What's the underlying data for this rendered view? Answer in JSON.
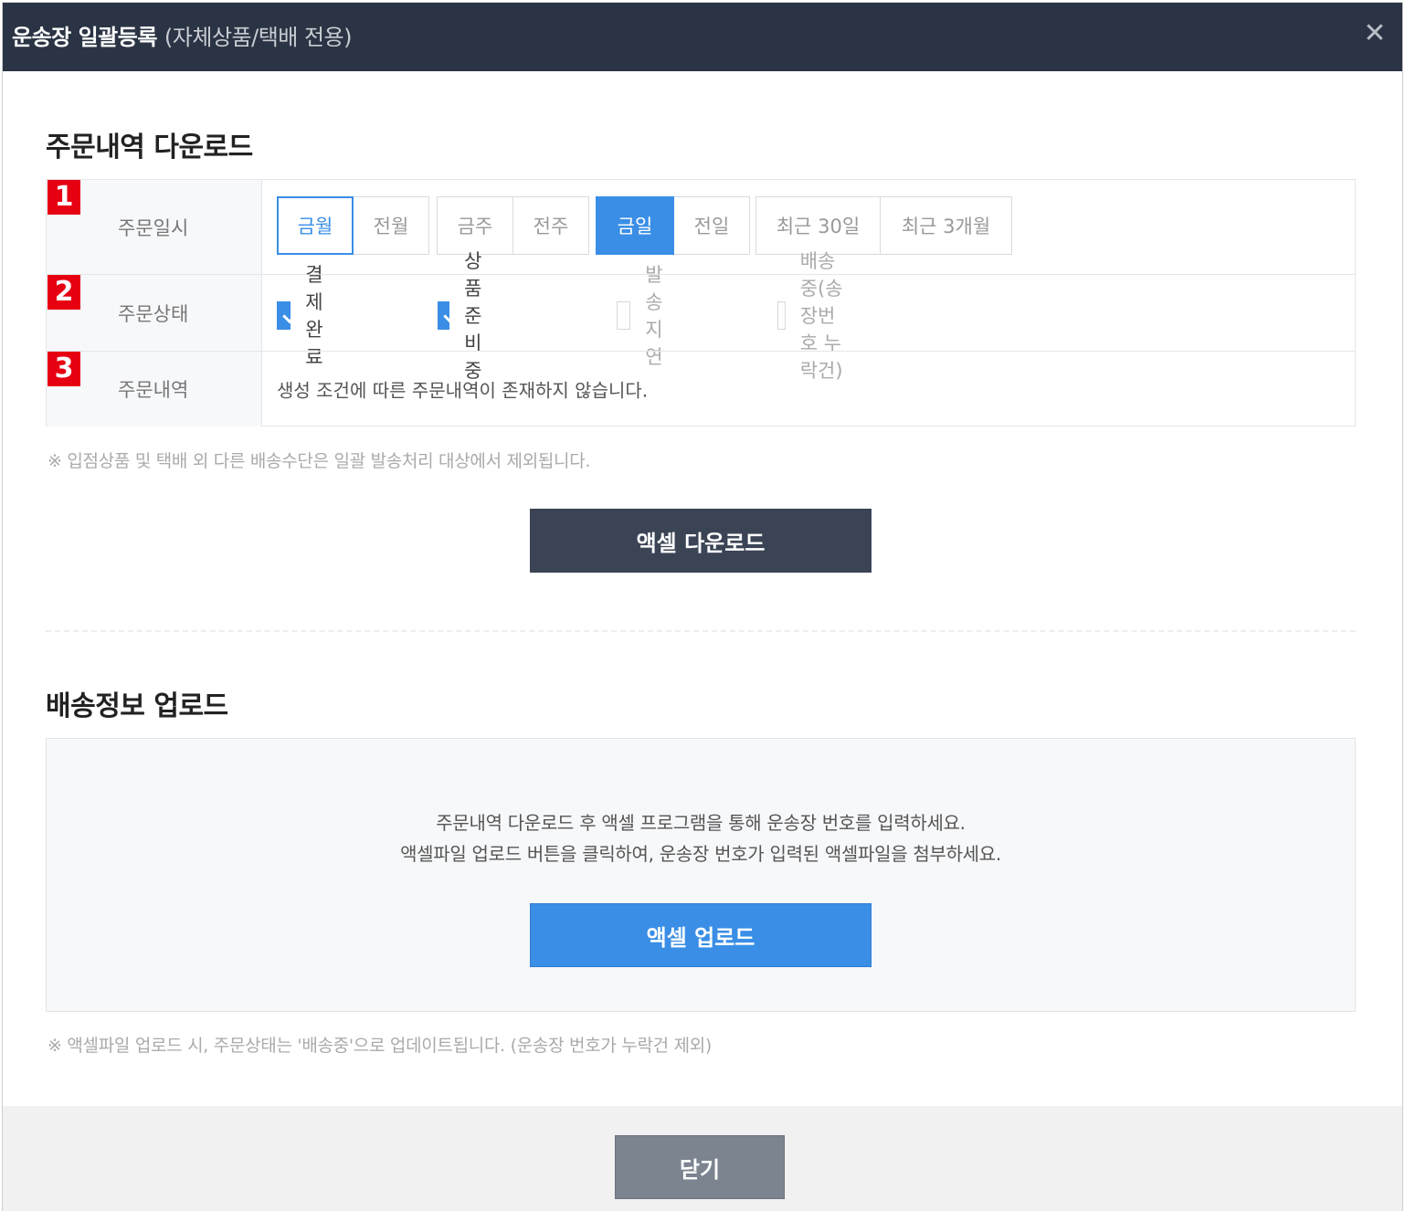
{
  "titlebar": {
    "title": "운송장 일괄등록",
    "subtitle": "(자체상품/택배 전용)",
    "close_icon": "close-icon"
  },
  "download_section": {
    "title": "주문내역 다운로드",
    "rows": [
      {
        "badge": "1",
        "label": "주문일시"
      },
      {
        "badge": "2",
        "label": "주문상태"
      },
      {
        "badge": "3",
        "label": "주문내역"
      }
    ],
    "date_groups": [
      [
        {
          "label": "금월",
          "state": "outline-active"
        },
        {
          "label": "전월",
          "state": "normal"
        }
      ],
      [
        {
          "label": "금주",
          "state": "normal"
        },
        {
          "label": "전주",
          "state": "normal"
        }
      ],
      [
        {
          "label": "금일",
          "state": "fill-active"
        },
        {
          "label": "전일",
          "state": "normal"
        }
      ],
      [
        {
          "label": "최근 30일",
          "state": "normal"
        },
        {
          "label": "최근 3개월",
          "state": "normal"
        }
      ]
    ],
    "status_checks": [
      {
        "label": "결제완료",
        "checked": true
      },
      {
        "label": "상품준비중",
        "checked": true
      },
      {
        "label": "발송지연",
        "checked": false
      },
      {
        "label": "배송중(송장번호 누락건)",
        "checked": false
      }
    ],
    "order_detail_text": "생성 조건에 따른 주문내역이 존재하지 않습니다.",
    "note": "※ 입점상품 및 택배 외 다른 배송수단은 일괄 발송처리 대상에서 제외됩니다.",
    "download_button": "액셀 다운로드"
  },
  "upload_section": {
    "title": "배송정보 업로드",
    "instruction_line1": "주문내역 다운로드 후 액셀 프로그램을 통해 운송장 번호를 입력하세요.",
    "instruction_line2": "액셀파일 업로드 버튼을 클릭하여, 운송장 번호가 입력된 액셀파일을 첨부하세요.",
    "upload_button": "액셀 업로드",
    "note": "※ 액셀파일 업로드 시, 주문상태는 '배송중'으로 업데이트됩니다. (운송장 번호가 누락건 제외)"
  },
  "footer": {
    "close_button": "닫기"
  },
  "colors": {
    "titlebar_bg": "#2b3444",
    "accent_blue": "#3a8ee6",
    "badge_red": "#e60012",
    "dark_button": "#3b4455",
    "close_button": "#7c8490"
  }
}
